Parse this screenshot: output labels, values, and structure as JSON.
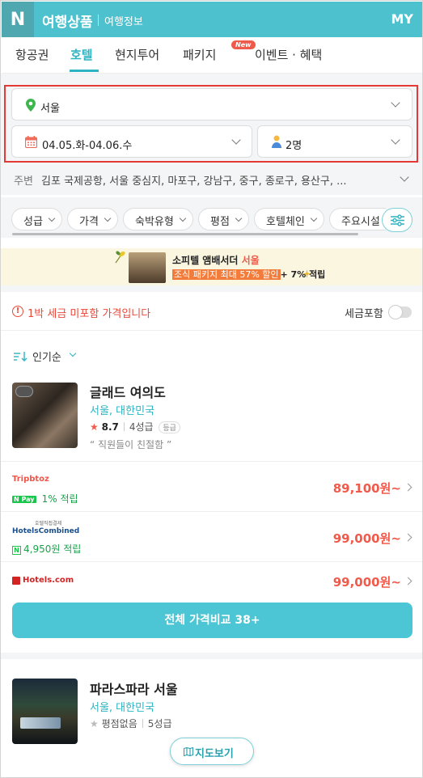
{
  "header": {
    "logo": "N",
    "title": "여행상품",
    "subtitle": "여행정보",
    "my": "MY"
  },
  "tabs": [
    {
      "label": "항공권"
    },
    {
      "label": "호텔",
      "active": true
    },
    {
      "label": "현지투어"
    },
    {
      "label": "패키지"
    },
    {
      "label": "이벤트 · 혜택",
      "badge": "New"
    }
  ],
  "search": {
    "location": "서울",
    "dates": "04.05.화-04.06.수",
    "guests": "2명",
    "nearby_label": "주변",
    "nearby_list": "김포 국제공항, 서울 중심지, 마포구, 강남구, 중구, 종로구, 용산구, ..."
  },
  "filters": [
    "성급",
    "가격",
    "숙박유형",
    "평점",
    "호텔체인",
    "주요시설"
  ],
  "banner": {
    "line1_prefix": "소피텔 앰배서더 ",
    "line1_accent": "서울",
    "line2_highlight": "조식 패키지 최대 57% 할인",
    "line2_suffix": "+ 7% 적립"
  },
  "tax": {
    "message": "1박 세금 미포함 가격입니다",
    "toggle_label": "세금포함",
    "toggle_on": false
  },
  "sort": {
    "icon": "=↓",
    "label": "인기순"
  },
  "hotels": [
    {
      "name": "글래드 여의도",
      "location": "서울, 대한민국",
      "score": "8.7",
      "grade": "4성급",
      "grade_badge": "등급",
      "review": "“ 직원들이 친절함 ”",
      "offers": [
        {
          "provider": "Tripbtoz",
          "point_badge": "N Pay",
          "point": "1% 적립",
          "price": "89,100원~"
        },
        {
          "provider_top": "호텔직접결제",
          "provider": "HotelsCombined",
          "point_badge": "N",
          "point": "4,950원 적립",
          "price": "99,000원~"
        },
        {
          "provider": "Hotels.com",
          "price": "99,000원~"
        }
      ],
      "compare_button": "전체 가격비교 38+"
    },
    {
      "name": "파라스파라 서울",
      "location": "서울, 대한민국",
      "score": "평점없음",
      "grade": "5성급"
    }
  ],
  "map_button": "지도보기",
  "colors": {
    "primary": "#4dc2ce",
    "accent": "#2eb3c2",
    "price": "#f05a4a",
    "highlight_border": "#e53935"
  }
}
